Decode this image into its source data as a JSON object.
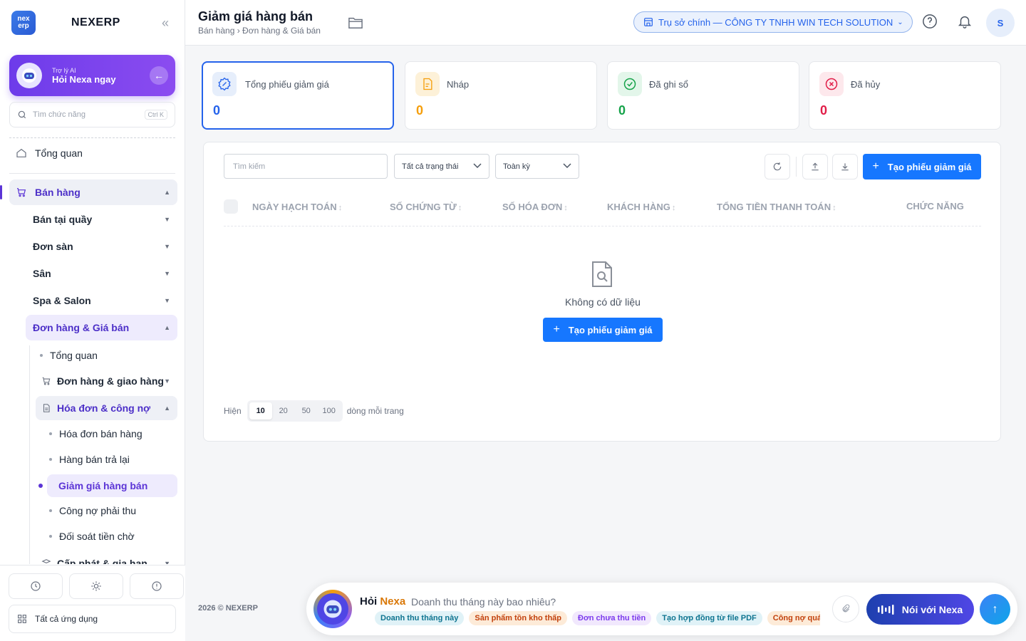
{
  "app": {
    "logo_line1": "nex",
    "logo_line2": "erp",
    "brand": "NEXERP",
    "collapse_icon": "double-chevron-left-icon"
  },
  "ai_assistant": {
    "small_label": "Trợ lý AI",
    "title": "Hỏi Nexa ngay"
  },
  "side_search": {
    "placeholder": "Tìm chức năng",
    "shortcut": "Ctrl K"
  },
  "nav": {
    "overview": "Tổng quan",
    "sales": "Bán hàng",
    "sales_children": [
      "Bán tại quầy",
      "Đơn sàn",
      "Sân",
      "Spa & Salon"
    ],
    "orders_pricing": "Đơn hàng & Giá bán",
    "op_overview": "Tổng quan",
    "orders_delivery": "Đơn hàng & giao hàng",
    "invoice_debt": "Hóa đơn & công nợ",
    "invoice_children": [
      "Hóa đơn bán hàng",
      "Hàng bán trả lại",
      "Giảm giá hàng bán",
      "Công nợ phải thu",
      "Đối soát tiền chờ"
    ],
    "next_item": "Cấp phát & gia hạn"
  },
  "side_bottom": {
    "all_apps": "Tất cả ứng dụng"
  },
  "header": {
    "title": "Giảm giá hàng bán",
    "breadcrumb": "Bán hàng › Đơn hàng & Giá bán",
    "branch": "Trụ sở chính — CÔNG TY TNHH WIN TECH SOLUTION",
    "avatar_initial": "S"
  },
  "stats": [
    {
      "label": "Tổng phiếu giảm giá",
      "value": "0",
      "color": "#2563eb",
      "icon": "discount-badge-icon"
    },
    {
      "label": "Nháp",
      "value": "0",
      "color": "#f59e0b",
      "icon": "draft-file-icon"
    },
    {
      "label": "Đã ghi sổ",
      "value": "0",
      "color": "#16a34a",
      "icon": "check-circle-icon"
    },
    {
      "label": "Đã hủy",
      "value": "0",
      "color": "#e11d48",
      "icon": "x-circle-icon"
    }
  ],
  "filters": {
    "search_placeholder": "Tìm kiếm",
    "status": "Tất cả trạng thái",
    "period": "Toàn kỳ"
  },
  "actions": {
    "create": "Tạo phiếu giảm giá"
  },
  "table": {
    "columns": [
      "NGÀY HẠCH TOÁN",
      "SỐ CHỨNG TỪ",
      "SỐ HÓA ĐƠN",
      "KHÁCH HÀNG",
      "TỔNG TIỀN THANH TOÁN",
      "CHỨC NĂNG"
    ],
    "empty_text": "Không có dữ liệu",
    "empty_button": "Tạo phiếu giảm giá"
  },
  "pager": {
    "show_label": "Hiện",
    "sizes": [
      "10",
      "20",
      "50",
      "100"
    ],
    "selected": "10",
    "per_page_label": "dòng mỗi trang"
  },
  "footer": {
    "copyright": "2026 © NEXERP",
    "ask_prefix": "Hỏi",
    "ask_name": "Nexa",
    "ask_prompt": "Doanh thu tháng này bao nhiêu?",
    "chips": [
      "Doanh thu tháng này",
      "Sản phẩm tồn kho thấp",
      "Đơn chưa thu tiền",
      "Tạo hợp đồng từ file PDF",
      "Công nợ quá hạn"
    ],
    "voice_button": "Nói với Nexa"
  },
  "colors": {
    "accent": "#1677ff",
    "purple": "#6d3bea"
  }
}
